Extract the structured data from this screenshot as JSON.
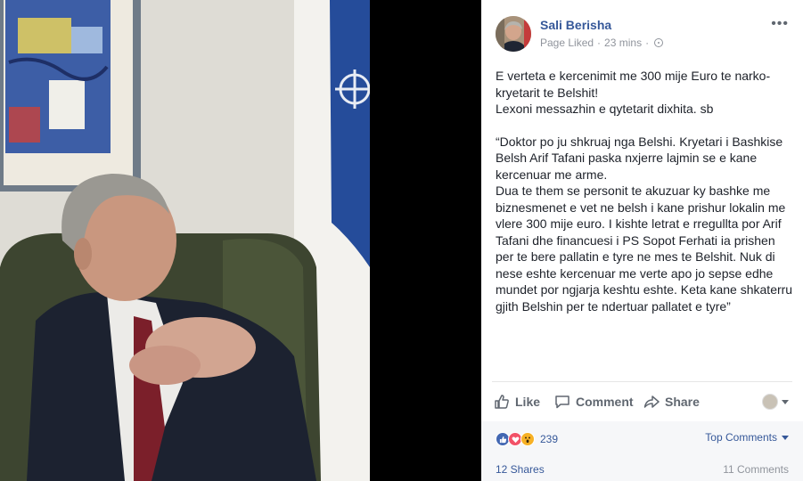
{
  "photo": {
    "description_icon": "photo-of-man-in-armchair"
  },
  "post": {
    "author": "Sali Berisha",
    "page_status": "Page Liked",
    "time": "23 mins",
    "privacy_icon": "globe-icon",
    "more_label": "•••",
    "paragraphs": [
      "E verteta e kercenimit me 300 mije Euro te narko-kryetarit te Belshit!\nLexoni messazhin e qytetarit dixhita. sb",
      "“Doktor po ju shkruaj nga Belshi. Kryetari i Bashkise Belsh Arif Tafani paska nxjerre lajmin se e kane kercenuar me arme.\nDua te them se personit te akuzuar ky bashke me biznesmenet e vet ne belsh i kane prishur lokalin me vlere 300 mije euro. I kishte letrat e rregullta por Arif Tafani dhe financuesi i PS Sopot Ferhati ia prishen per te bere pallatin e tyre ne mes te Belshit. Nuk di nese eshte kercenuar me verte apo jo sepse edhe mundet por ngjarja keshtu eshte. Keta kane shkaterru gjith Belshin per te ndertuar pallatet e tyre”"
    ],
    "actions": {
      "like": "Like",
      "comment": "Comment",
      "share": "Share"
    },
    "reactions_count": "239",
    "top_comments": "Top Comments",
    "shares": "12 Shares",
    "comments": "11 Comments"
  },
  "colors": {
    "link": "#365899",
    "muted": "#90949c",
    "text": "#1d2129",
    "like_blue": "#4267b2",
    "love_red": "#f25268",
    "wow_yellow": "#f7b125"
  }
}
